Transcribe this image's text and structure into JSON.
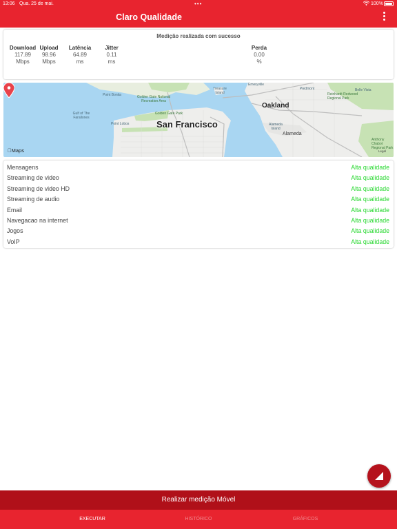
{
  "status_bar": {
    "time": "13:06",
    "date": "Qua. 25 de mai.",
    "battery": "100%"
  },
  "header": {
    "title": "Claro Qualidade"
  },
  "results": {
    "headline": "Medição realizada com sucesso",
    "metrics": [
      {
        "label": "Download",
        "value": "117.89",
        "unit": "Mbps"
      },
      {
        "label": "Upload",
        "value": "98.96",
        "unit": "Mbps"
      },
      {
        "label": "Latência",
        "value": "64.89",
        "unit": "ms"
      },
      {
        "label": "Jitter",
        "value": "0.11",
        "unit": "ms"
      },
      {
        "label": "Perda",
        "value": "0.00",
        "unit": "%"
      }
    ]
  },
  "map": {
    "main_city": "San Francisco",
    "oakland": "Oakland",
    "alameda": "Alameda",
    "emeryville": "Emeryville",
    "piedmont": "Piedmont",
    "yerba_buena": "Treasure Island",
    "alameda_island": "Alameda Island",
    "point_bonita": "Point Bonita",
    "point_lobos": "Point Lobos",
    "gulf": "Gulf of The Farallones",
    "presidio": "Golden Gate National Recreation Area",
    "ggpark": "Golden Gate Park",
    "reinhardt": "Reinhardt Redwood Regional Park",
    "anthony": "Anthony Chabot Regional Park",
    "belle_vista": "Belle Vista",
    "logo": "Maps",
    "legal": "Legal",
    "colors": {
      "water": "#a9d6f2",
      "land": "#eeeeec",
      "park": "#c7e2b4",
      "pin": "#e8424b"
    }
  },
  "quality": {
    "rows": [
      {
        "service": "Mensagens",
        "rating": "Alta qualidade"
      },
      {
        "service": "Streaming de video",
        "rating": "Alta qualidade"
      },
      {
        "service": "Streaming de video HD",
        "rating": "Alta qualidade"
      },
      {
        "service": "Streaming de audio",
        "rating": "Alta qualidade"
      },
      {
        "service": "Email",
        "rating": "Alta qualidade"
      },
      {
        "service": "Navegacao na internet",
        "rating": "Alta qualidade"
      },
      {
        "service": "Jogos",
        "rating": "Alta qualidade"
      },
      {
        "service": "VoIP",
        "rating": "Alta qualidade"
      }
    ],
    "rating_color": "#27d82f"
  },
  "actions": {
    "measure_label": "Realizar medição Móvel"
  },
  "tabs": [
    {
      "label": "EXECUTAR",
      "active": true
    },
    {
      "label": "HISTÓRICO",
      "active": false
    },
    {
      "label": "GRÁFICOS",
      "active": false
    }
  ],
  "brand_color": "#e8242f"
}
